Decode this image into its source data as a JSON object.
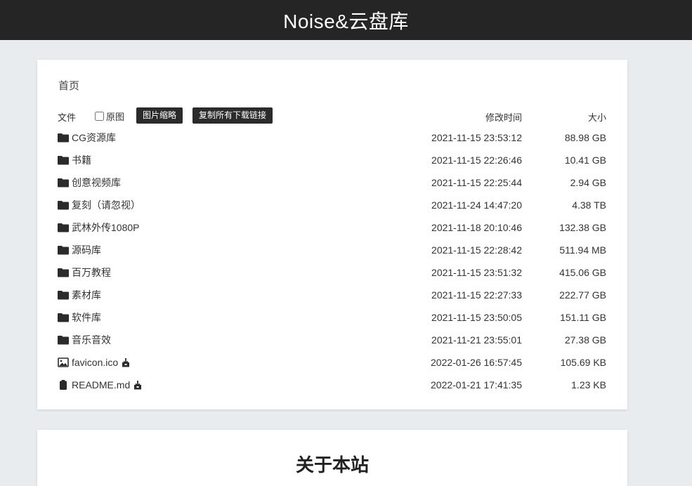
{
  "site": {
    "title": "Noise&云盘库"
  },
  "breadcrumb": "首页",
  "table": {
    "col_file": "文件",
    "original_label": "原图",
    "thumb_button": "图片缩略",
    "copy_button": "复制所有下载链接",
    "col_modified": "修改时间",
    "col_size": "大小",
    "rows": [
      {
        "name": "CG资源库",
        "date": "2021-11-15 23:53:12",
        "size": "88.98 GB",
        "icon": "folder-icon"
      },
      {
        "name": "书籍",
        "date": "2021-11-15 22:26:46",
        "size": "10.41 GB",
        "icon": "folder-icon"
      },
      {
        "name": "创意视频库",
        "date": "2021-11-15 22:25:44",
        "size": "2.94 GB",
        "icon": "folder-icon"
      },
      {
        "name": "复刻（请忽视）",
        "date": "2021-11-24 14:47:20",
        "size": "4.38 TB",
        "icon": "folder-icon"
      },
      {
        "name": "武林外传1080P",
        "date": "2021-11-18 20:10:46",
        "size": "132.38 GB",
        "icon": "folder-icon"
      },
      {
        "name": "源码库",
        "date": "2021-11-15 22:28:42",
        "size": "511.94 MB",
        "icon": "folder-icon"
      },
      {
        "name": "百万教程",
        "date": "2021-11-15 23:51:32",
        "size": "415.06 GB",
        "icon": "folder-icon"
      },
      {
        "name": "素材库",
        "date": "2021-11-15 22:27:33",
        "size": "222.77 GB",
        "icon": "folder-icon"
      },
      {
        "name": "软件库",
        "date": "2021-11-15 23:50:05",
        "size": "151.11 GB",
        "icon": "folder-icon"
      },
      {
        "name": "音乐音效",
        "date": "2021-11-21 23:55:01",
        "size": "27.38 GB",
        "icon": "folder-icon"
      },
      {
        "name": "favicon.ico",
        "date": "2022-01-26 16:57:45",
        "size": "105.69 KB",
        "icon": "image-file-icon"
      },
      {
        "name": "README.md",
        "date": "2022-01-21 17:41:35",
        "size": "1.23 KB",
        "icon": "clipboard-file-icon"
      }
    ]
  },
  "about": {
    "title": "关于本站"
  }
}
